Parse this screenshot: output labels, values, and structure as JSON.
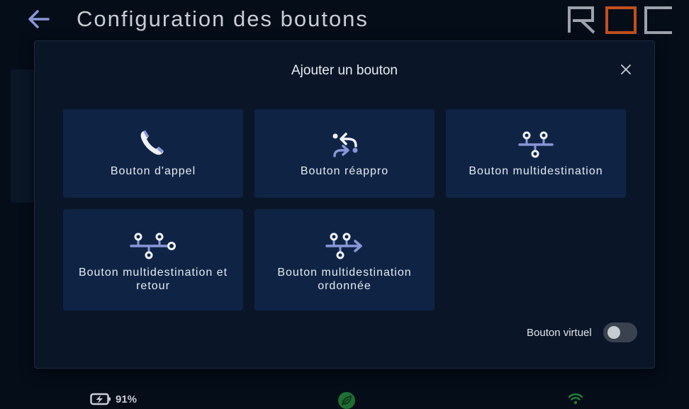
{
  "header": {
    "title": "Configuration des boutons",
    "logo_text": "ROC"
  },
  "modal": {
    "title": "Ajouter un bouton",
    "options": [
      {
        "label": "Bouton d'appel",
        "icon": "phone-icon"
      },
      {
        "label": "Bouton réappro",
        "icon": "swap-arrows-icon"
      },
      {
        "label": "Bouton multidestination",
        "icon": "multidestination-icon"
      },
      {
        "label": "Bouton multidestination et retour",
        "icon": "multidestination-return-icon"
      },
      {
        "label": "Bouton multidestination ordonnée",
        "icon": "multidestination-ordered-icon"
      }
    ],
    "virtual_toggle": {
      "label": "Bouton virtuel",
      "on": false
    }
  },
  "status_bar": {
    "battery_level": "91%",
    "icons": [
      "battery-charging-icon",
      "leaf-icon",
      "wifi-icon"
    ]
  },
  "colors": {
    "background": "#050d19",
    "modal": "#0a1628",
    "card": "#0f2445",
    "icon_accent": "#8a96d8",
    "logo_accent": "#c2501e",
    "status_green": "#1f8a3a"
  }
}
